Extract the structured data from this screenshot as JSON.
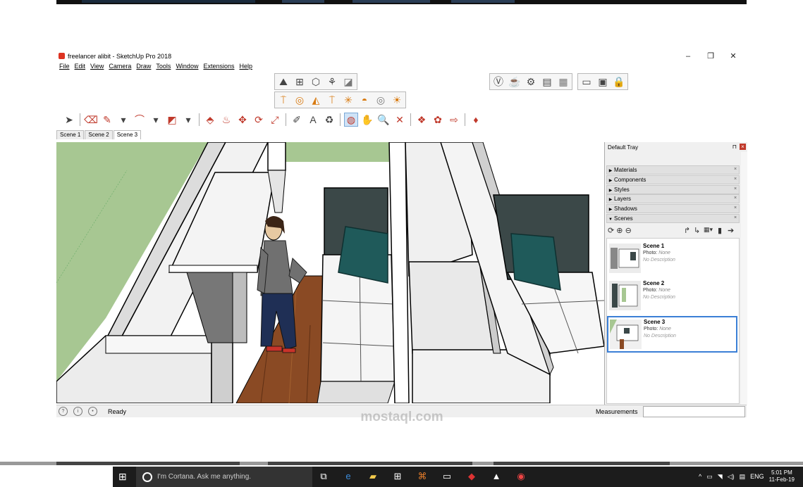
{
  "window": {
    "title": "freelancer alibit - SketchUp Pro 2018",
    "controls": [
      "–",
      "❐",
      "✕"
    ]
  },
  "menu": [
    "File",
    "Edit",
    "View",
    "Camera",
    "Draw",
    "Tools",
    "Window",
    "Extensions",
    "Help"
  ],
  "scene_tabs": [
    {
      "label": "Scene 1",
      "active": false
    },
    {
      "label": "Scene 2",
      "active": false
    },
    {
      "label": "Scene 3",
      "active": true
    }
  ],
  "tray": {
    "title": "Default Tray",
    "pin": "⊓",
    "close": "×",
    "panels": [
      {
        "label": "Materials",
        "expanded": false
      },
      {
        "label": "Components",
        "expanded": false
      },
      {
        "label": "Styles",
        "expanded": false
      },
      {
        "label": "Layers",
        "expanded": false
      },
      {
        "label": "Shadows",
        "expanded": false
      },
      {
        "label": "Scenes",
        "expanded": true
      }
    ],
    "panel_close": "×",
    "scenes": [
      {
        "name": "Scene 1",
        "photo_label": "Photo:",
        "photo": "None",
        "description": "No Description",
        "active": false
      },
      {
        "name": "Scene 2",
        "photo_label": "Photo:",
        "photo": "None",
        "description": "No Description",
        "active": false
      },
      {
        "name": "Scene 3",
        "photo_label": "Photo:",
        "photo": "None",
        "description": "No Description",
        "active": true
      }
    ]
  },
  "status": {
    "ready": "Ready",
    "measurements_label": "Measurements",
    "measurements_value": ""
  },
  "taskbar": {
    "search_placeholder": "I'm Cortana. Ask me anything.",
    "lang": "ENG",
    "time": "5:01 PM",
    "date": "11-Feb-19"
  },
  "watermark": "mostaql.com",
  "colors": {
    "grass": "#a7c792",
    "floor": "#8a4a24",
    "headboard": "#3b4848",
    "pillow": "#1f5a5a",
    "selection": "#3b7fd6",
    "taskbar": "#1c1c1c"
  }
}
